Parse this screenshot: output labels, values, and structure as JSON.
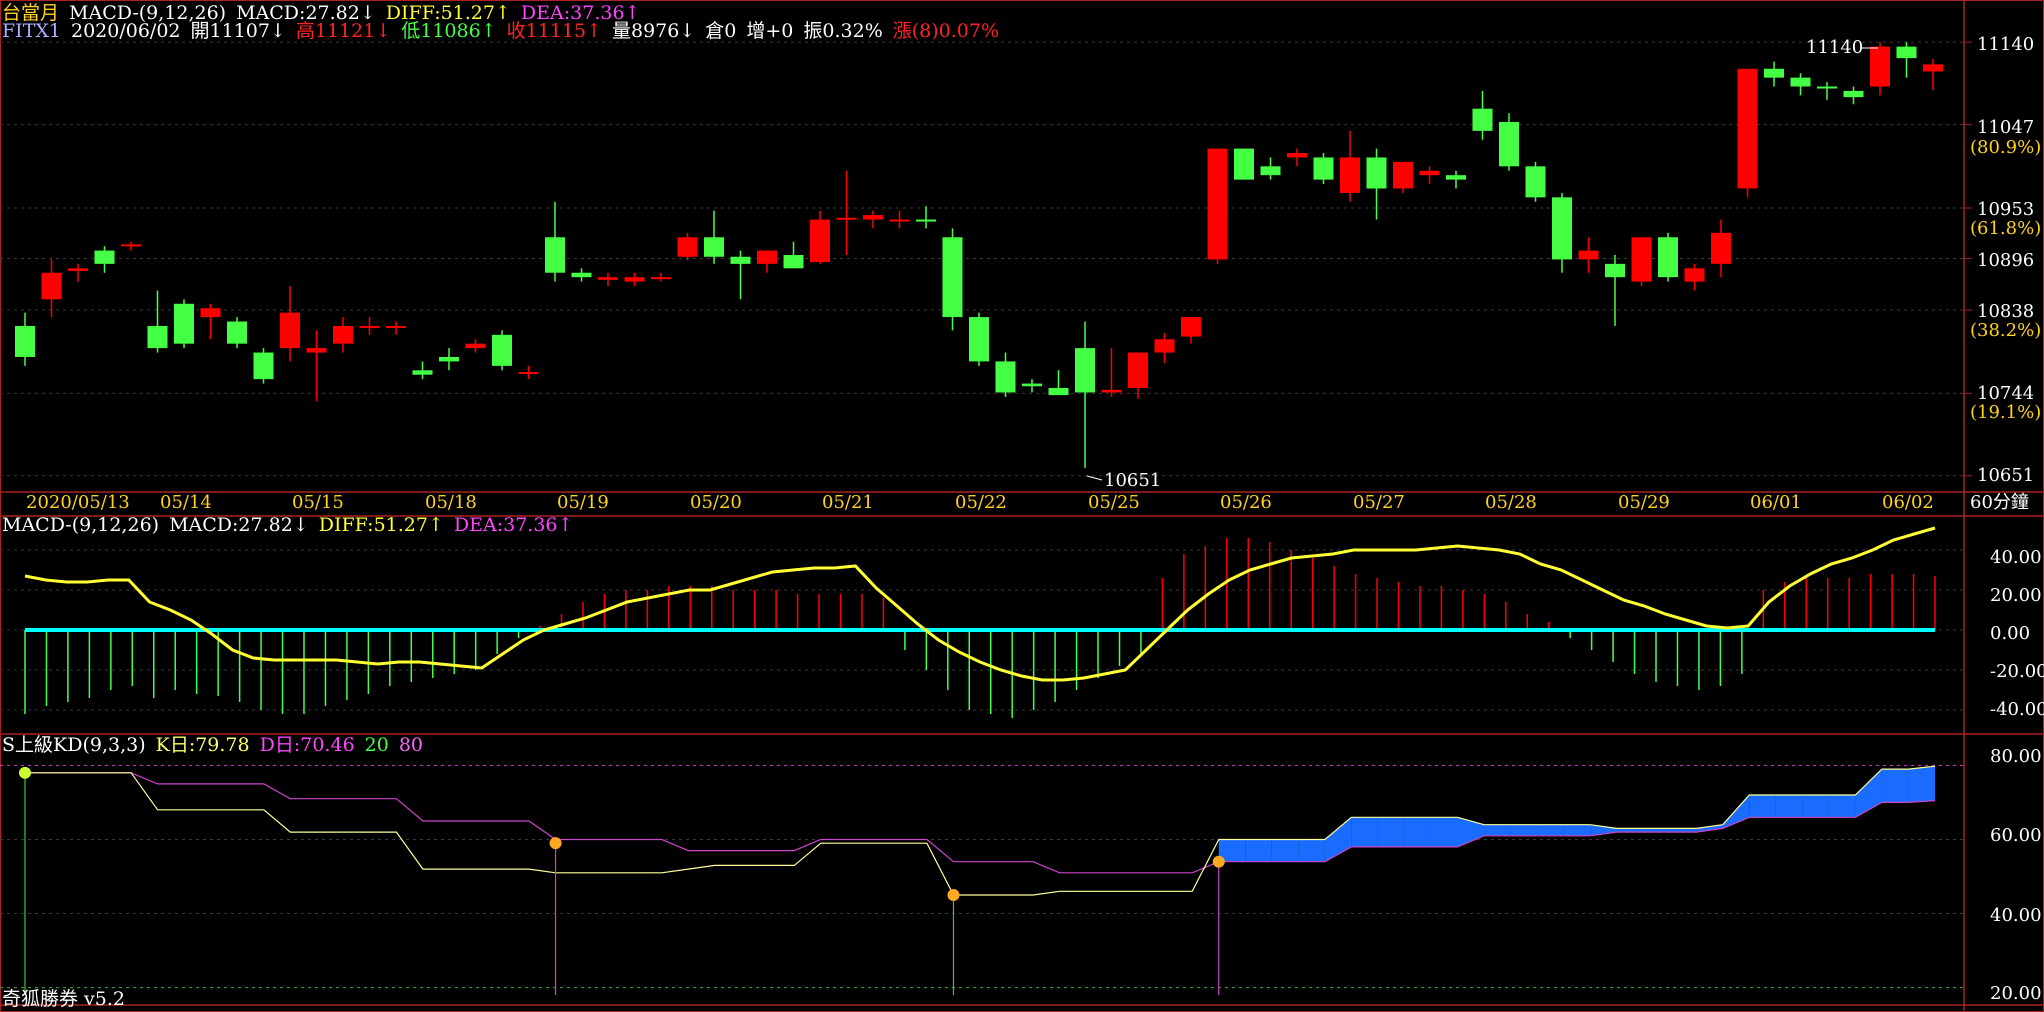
{
  "header": {
    "instrument": "台當月",
    "macd_label": "MACD-(9,12,26)",
    "macd_value": "MACD:27.82↓",
    "diff_value": "DIFF:51.27↑",
    "dea_value": "DEA:37.36↑",
    "symbol": "FITX1",
    "date": "2020/06/02",
    "open": "開11107↓",
    "high": "高11121↓",
    "low": "低11086↑",
    "close": "收11115↑",
    "volume": "量8976↓",
    "oi": "倉0",
    "change": "增+0",
    "amplitude": "振0.32%",
    "rise": "漲(8)0.07%"
  },
  "price_axis": {
    "ticks": [
      "11140",
      "11047",
      "10953",
      "10896",
      "10838",
      "10744",
      "10651"
    ],
    "pct": [
      "(80.9%)",
      "(61.8%)",
      "(38.2%)",
      "(19.1%)"
    ]
  },
  "annotations": {
    "high_label": "11140",
    "low_label": "10651"
  },
  "time_axis": {
    "labels": [
      "2020/05/13",
      "05/14",
      "05/15",
      "05/18",
      "05/19",
      "05/20",
      "05/21",
      "05/22",
      "05/25",
      "05/26",
      "05/27",
      "05/28",
      "05/29",
      "06/01",
      "06/02"
    ],
    "interval": "60分鐘"
  },
  "macd_panel": {
    "label": "MACD-(9,12,26)",
    "macd_value": "MACD:27.82↓",
    "diff_value": "DIFF:51.27↑",
    "dea_value": "DEA:37.36↑",
    "ticks": [
      "40.00",
      "20.00",
      "0.00",
      "-20.00",
      "-40.00"
    ]
  },
  "kd_panel": {
    "label": "S上級KD(9,3,3)",
    "k_value": "K日:79.78",
    "d_value": "D日:70.46",
    "level_low": "20",
    "level_high": "80",
    "ticks": [
      "80.00",
      "60.00",
      "40.00",
      "20.00"
    ]
  },
  "footer": {
    "product": "奇狐勝券 v5.2"
  },
  "colors": {
    "up": "#ff0000",
    "down": "#44ff44",
    "diff": "#ffff33",
    "zero": "#00ffff",
    "kd_fill": "#1a6cff",
    "k": "#ffff99",
    "d": "#cc44cc"
  },
  "chart_data": {
    "type": "candlestick",
    "candles": [
      [
        10820,
        10835,
        10775,
        10785
      ],
      [
        10850,
        10895,
        10830,
        10880
      ],
      [
        10882,
        10890,
        10870,
        10885
      ],
      [
        10905,
        10910,
        10880,
        10890
      ],
      [
        10910,
        10915,
        10905,
        10912
      ],
      [
        10820,
        10860,
        10790,
        10795
      ],
      [
        10845,
        10850,
        10795,
        10800
      ],
      [
        10830,
        10845,
        10805,
        10840
      ],
      [
        10825,
        10830,
        10795,
        10800
      ],
      [
        10790,
        10795,
        10755,
        10760
      ],
      [
        10795,
        10865,
        10780,
        10835
      ],
      [
        10790,
        10815,
        10735,
        10795
      ],
      [
        10800,
        10830,
        10790,
        10820
      ],
      [
        10818,
        10830,
        10810,
        10820
      ],
      [
        10820,
        10825,
        10810,
        10820
      ],
      [
        10770,
        10780,
        10760,
        10765
      ],
      [
        10785,
        10795,
        10770,
        10780
      ],
      [
        10795,
        10805,
        10790,
        10800
      ],
      [
        10810,
        10815,
        10770,
        10775
      ],
      [
        10768,
        10775,
        10760,
        10768
      ],
      [
        10920,
        10960,
        10870,
        10880
      ],
      [
        10880,
        10885,
        10870,
        10875
      ],
      [
        10872,
        10880,
        10865,
        10875
      ],
      [
        10870,
        10880,
        10865,
        10875
      ],
      [
        10875,
        10880,
        10870,
        10875
      ],
      [
        10898,
        10925,
        10894,
        10920
      ],
      [
        10920,
        10950,
        10890,
        10898
      ],
      [
        10898,
        10905,
        10850,
        10890
      ],
      [
        10890,
        10900,
        10880,
        10905
      ],
      [
        10900,
        10915,
        10890,
        10885
      ],
      [
        10892,
        10950,
        10890,
        10940
      ],
      [
        10940,
        10995,
        10900,
        10942
      ],
      [
        10940,
        10950,
        10930,
        10945
      ],
      [
        10938,
        10950,
        10930,
        10940
      ],
      [
        10940,
        10955,
        10930,
        10938
      ],
      [
        10920,
        10930,
        10815,
        10830
      ],
      [
        10830,
        10835,
        10775,
        10780
      ],
      [
        10780,
        10790,
        10740,
        10745
      ],
      [
        10755,
        10760,
        10745,
        10752
      ],
      [
        10750,
        10770,
        10745,
        10742
      ],
      [
        10795,
        10825,
        10660,
        10745
      ],
      [
        10745,
        10795,
        10740,
        10748
      ],
      [
        10750,
        10790,
        10738,
        10790
      ],
      [
        10790,
        10812,
        10778,
        10805
      ],
      [
        10808,
        10830,
        10800,
        10830
      ],
      [
        10895,
        11020,
        10890,
        11020
      ],
      [
        11020,
        11020,
        10985,
        10985
      ],
      [
        11000,
        11010,
        10985,
        10990
      ],
      [
        11010,
        11020,
        11000,
        11015
      ],
      [
        11010,
        11015,
        10980,
        10985
      ],
      [
        10970,
        11040,
        10960,
        11010
      ],
      [
        11010,
        11020,
        10940,
        10975
      ],
      [
        10975,
        11005,
        10970,
        11005
      ],
      [
        10990,
        11000,
        10980,
        10995
      ],
      [
        10990,
        10995,
        10975,
        10985
      ],
      [
        11065,
        11085,
        11030,
        11040
      ],
      [
        11050,
        11060,
        10995,
        11000
      ],
      [
        11000,
        11005,
        10960,
        10965
      ],
      [
        10965,
        10970,
        10880,
        10895
      ],
      [
        10895,
        10920,
        10880,
        10905
      ],
      [
        10890,
        10900,
        10820,
        10875
      ],
      [
        10870,
        10920,
        10865,
        10920
      ],
      [
        10920,
        10925,
        10870,
        10875
      ],
      [
        10870,
        10890,
        10860,
        10885
      ],
      [
        10890,
        10940,
        10875,
        10925
      ],
      [
        10975,
        11110,
        10965,
        11110
      ],
      [
        11110,
        11118,
        11090,
        11100
      ],
      [
        11100,
        11105,
        11080,
        11090
      ],
      [
        11090,
        11095,
        11075,
        11088
      ],
      [
        11085,
        11090,
        11070,
        11078
      ],
      [
        11090,
        11140,
        11080,
        11135
      ],
      [
        11135,
        11140,
        11100,
        11122
      ],
      [
        11107,
        11121,
        11086,
        11115
      ]
    ],
    "day_labels": [
      "2020/05/13",
      "05/14",
      "05/15",
      "05/18",
      "05/19",
      "05/20",
      "05/21",
      "05/22",
      "05/25",
      "05/26",
      "05/27",
      "05/28",
      "05/29",
      "06/01",
      "06/02"
    ],
    "price_ticks": [
      11140,
      11047,
      10953,
      10896,
      10838,
      10744,
      10651
    ],
    "price_range": [
      10635,
      11165
    ],
    "macd": {
      "diff": [
        27,
        25,
        24,
        24,
        25,
        25,
        14,
        10,
        5,
        -2,
        -10,
        -14,
        -15,
        -15,
        -15,
        -15,
        -16,
        -17,
        -16,
        -16,
        -17,
        -18,
        -19,
        -12,
        -5,
        0,
        3,
        6,
        10,
        14,
        16,
        18,
        20,
        20,
        23,
        26,
        29,
        30,
        31,
        31,
        32,
        21,
        12,
        3,
        -5,
        -11,
        -16,
        -20,
        -23,
        -25,
        -25,
        -24,
        -22,
        -20,
        -10,
        0,
        10,
        18,
        25,
        30,
        33,
        36,
        37,
        38,
        40,
        40,
        40,
        40,
        41,
        42,
        41,
        40,
        38,
        33,
        30,
        25,
        20,
        15,
        12,
        8,
        5,
        2,
        1,
        2,
        14,
        22,
        28,
        33,
        36,
        40,
        45,
        48,
        51
      ],
      "hist": [
        -42,
        -38,
        -36,
        -34,
        -30,
        -28,
        -34,
        -30,
        -32,
        -33,
        -36,
        -40,
        -42,
        -42,
        -38,
        -35,
        -32,
        -28,
        -26,
        -24,
        -22,
        -20,
        -12,
        -4,
        2,
        8,
        14,
        18,
        20,
        20,
        22,
        22,
        22,
        20,
        20,
        20,
        18,
        18,
        18,
        18,
        16,
        -10,
        -20,
        -30,
        -40,
        -42,
        -44,
        -40,
        -36,
        -30,
        -24,
        -18,
        -12,
        26,
        38,
        42,
        46,
        46,
        44,
        40,
        36,
        32,
        28,
        26,
        24,
        22,
        22,
        20,
        18,
        14,
        8,
        4,
        -4,
        -10,
        -16,
        -22,
        -26,
        -28,
        -30,
        -28,
        -22,
        20,
        24,
        26,
        26,
        26,
        28,
        28,
        28,
        27
      ]
    },
    "kd": {
      "k": [
        78,
        78,
        78,
        78,
        78,
        68,
        68,
        68,
        68,
        68,
        62,
        62,
        62,
        62,
        62,
        52,
        52,
        52,
        52,
        52,
        51,
        51,
        51,
        51,
        51,
        52,
        53,
        53,
        53,
        53,
        59,
        59,
        59,
        59,
        59,
        45,
        45,
        45,
        45,
        46,
        46,
        46,
        46,
        46,
        46,
        60,
        60,
        60,
        60,
        60,
        66,
        66,
        66,
        66,
        66,
        64,
        64,
        64,
        64,
        64,
        63,
        63,
        63,
        63,
        64,
        72,
        72,
        72,
        72,
        72,
        79,
        79,
        79.78
      ],
      "d": [
        78,
        78,
        78,
        78,
        78,
        75,
        75,
        75,
        75,
        75,
        71,
        71,
        71,
        71,
        71,
        65,
        65,
        65,
        65,
        65,
        60,
        60,
        60,
        60,
        60,
        57,
        57,
        57,
        57,
        57,
        60,
        60,
        60,
        60,
        60,
        54,
        54,
        54,
        54,
        51,
        51,
        51,
        51,
        51,
        51,
        54,
        54,
        54,
        54,
        54,
        58,
        58,
        58,
        58,
        58,
        61,
        61,
        61,
        61,
        61,
        62,
        62,
        62,
        62,
        63,
        66,
        66,
        66,
        66,
        66,
        70,
        70,
        70.46
      ]
    }
  }
}
